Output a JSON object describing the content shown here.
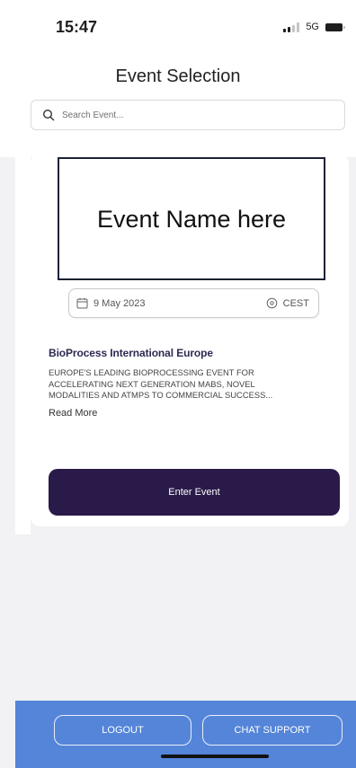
{
  "status_bar": {
    "time": "15:47",
    "network": "5G",
    "signal_icon": "signal-bars-icon",
    "battery_icon": "battery-icon"
  },
  "header": {
    "title": "Event Selection"
  },
  "search": {
    "placeholder": "Search Event...",
    "value": "",
    "icon": "search-icon"
  },
  "event_card": {
    "name_placeholder": "Event Name here",
    "date": "9 May 2023",
    "date_icon": "calendar-icon",
    "timezone": "CEST",
    "timezone_icon": "location-pin-icon",
    "title": "BioProcess International Europe",
    "description_lines": [
      "EUROPE'S LEADING BIOPROCESSING EVENT FOR",
      "ACCELERATING NEXT GENERATION MABS, NOVEL",
      "MODALITIES AND ATMPS TO COMMERCIAL SUCCESS..."
    ],
    "read_more_label": "Read More",
    "enter_button_label": "Enter Event"
  },
  "footer": {
    "logout_label": "LOGOUT",
    "chat_support_label": "CHAT SUPPORT"
  },
  "colors": {
    "primary_button": "#291a49",
    "footer_background": "#5585d8",
    "event_title": "#2c2a52",
    "page_background": "#f2f2f4"
  }
}
